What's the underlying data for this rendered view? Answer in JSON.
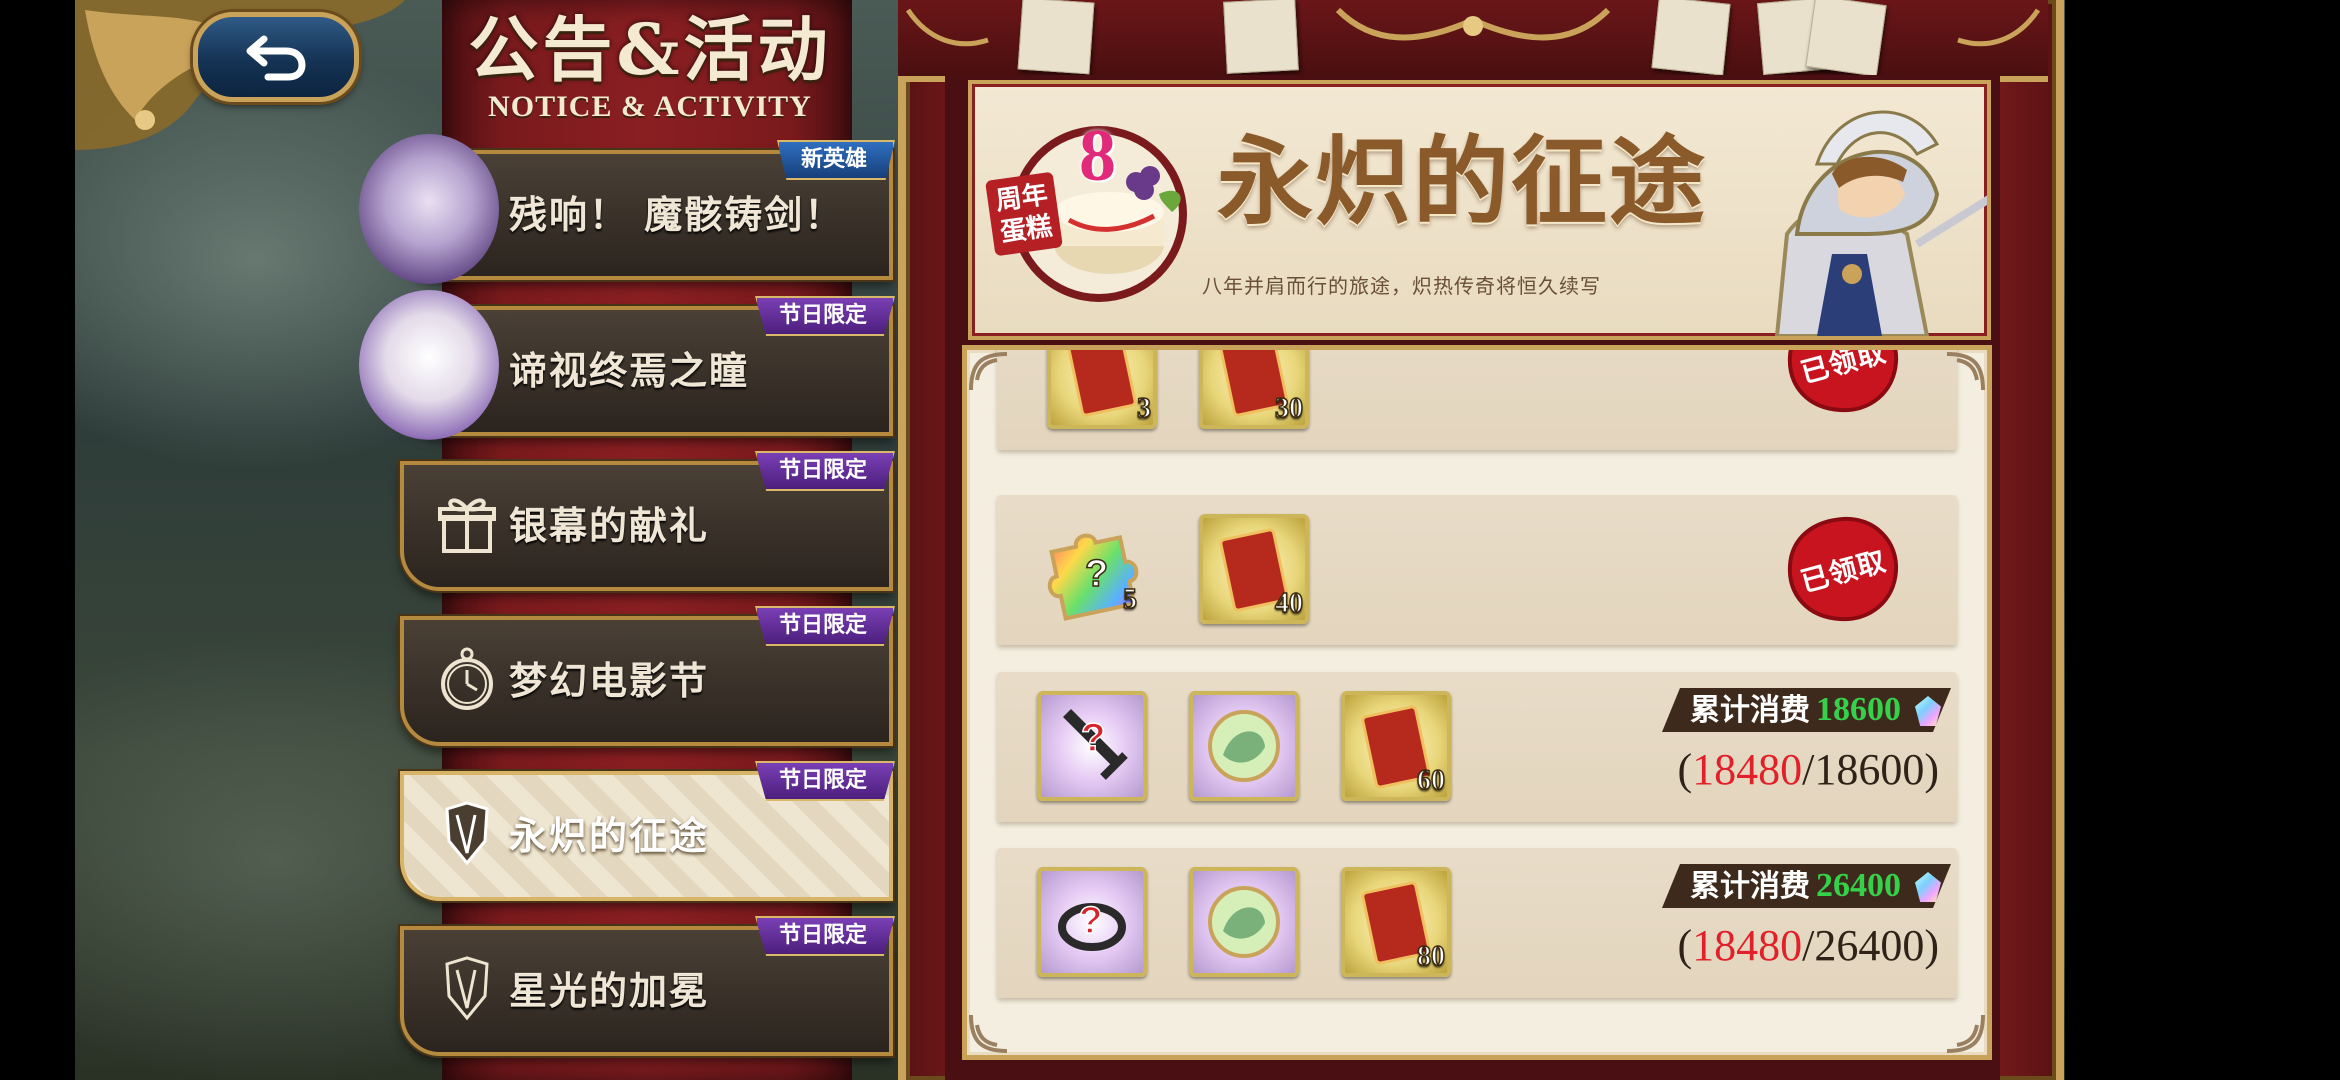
{
  "header": {
    "title_cn": "公告&活动",
    "title_en": "NOTICE & ACTIVITY"
  },
  "back_button": {
    "icon": "back-arrow-icon"
  },
  "tabs": [
    {
      "label": "残响！ 魔骸铸剑！",
      "badge": "新英雄",
      "badge_color": "#2f6fc0",
      "icon": "hero-portrait",
      "selected": false
    },
    {
      "label": "谛视终焉之瞳",
      "badge": "节日限定",
      "badge_color": "#7a3fb5",
      "icon": "hero-portrait",
      "selected": false
    },
    {
      "label": "银幕的献礼",
      "badge": "节日限定",
      "badge_color": "#7a3fb5",
      "icon": "gift-icon",
      "selected": false
    },
    {
      "label": "梦幻电影节",
      "badge": "节日限定",
      "badge_color": "#7a3fb5",
      "icon": "pocket-watch-icon",
      "selected": false
    },
    {
      "label": "永炽的征途",
      "badge": "节日限定",
      "badge_color": "#7a3fb5",
      "icon": "crest-icon",
      "selected": true
    },
    {
      "label": "星光的加冕",
      "badge": "节日限定",
      "badge_color": "#7a3fb5",
      "icon": "crest-icon",
      "selected": false
    }
  ],
  "banner": {
    "anniversary_tag": "周年蛋糕",
    "anniversary_number": "8",
    "title": "永炽的征途",
    "subtitle": "八年并肩而行的旅途，炽热传奇将恒久续写"
  },
  "rewards": [
    {
      "items": [
        {
          "type": "card",
          "qty": "3"
        },
        {
          "type": "card",
          "qty": "30"
        }
      ],
      "status": "已领取"
    },
    {
      "items": [
        {
          "type": "puzzle",
          "qty": "5"
        },
        {
          "type": "card",
          "qty": "40"
        }
      ],
      "status": "已领取"
    },
    {
      "items": [
        {
          "type": "mystery-sword",
          "qty": ""
        },
        {
          "type": "orb",
          "qty": ""
        },
        {
          "type": "card",
          "qty": "60"
        }
      ],
      "spend_label": "累计消费",
      "spend_target": "18600",
      "progress_current": "18480",
      "progress_total": "18600"
    },
    {
      "items": [
        {
          "type": "mystery-ring",
          "qty": ""
        },
        {
          "type": "orb",
          "qty": ""
        },
        {
          "type": "card",
          "qty": "80"
        }
      ],
      "spend_label": "累计消费",
      "spend_target": "26400",
      "progress_current": "18480",
      "progress_total": "26400"
    }
  ],
  "colors": {
    "gold": "#c9a35a",
    "crimson": "#8a1f22",
    "progress_red": "#e2202a",
    "spend_green": "#36d14a"
  }
}
